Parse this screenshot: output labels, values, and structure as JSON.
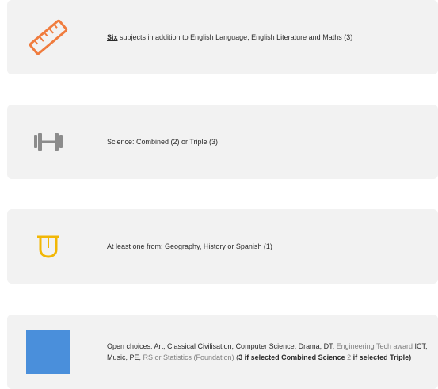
{
  "cards": [
    {
      "icon": "ruler-icon",
      "text": {
        "lead": "Six",
        "rest": " subjects in addition to English Language, English Literature and Maths (3)"
      }
    },
    {
      "icon": "dumbbell-icon",
      "text": {
        "main": "Science: Combined (2) or Triple (3)"
      }
    },
    {
      "icon": "tongue-icon",
      "text": {
        "main": "At least one from: Geography, History or Spanish (1)"
      }
    },
    {
      "icon": "blue-square-icon",
      "text": {
        "p1": "Open choices: Art, Classical Civilisation, Computer Science, Drama, DT, ",
        "p2": "Engineering Tech award",
        "p3": " ICT, Music, PE, ",
        "p4": "RS or Statistics (Foundation)",
        "p5": " (",
        "p6": "3 if selected Combined Science",
        "p7": " ",
        "p8": "2",
        "p9": " if selected Triple)"
      }
    }
  ],
  "colors": {
    "card_bg": "#f2f2f2",
    "ruler": "#f07c3e",
    "dumbbell": "#8c8c8c",
    "tongue": "#f2b705",
    "square": "#4a8fdb"
  }
}
